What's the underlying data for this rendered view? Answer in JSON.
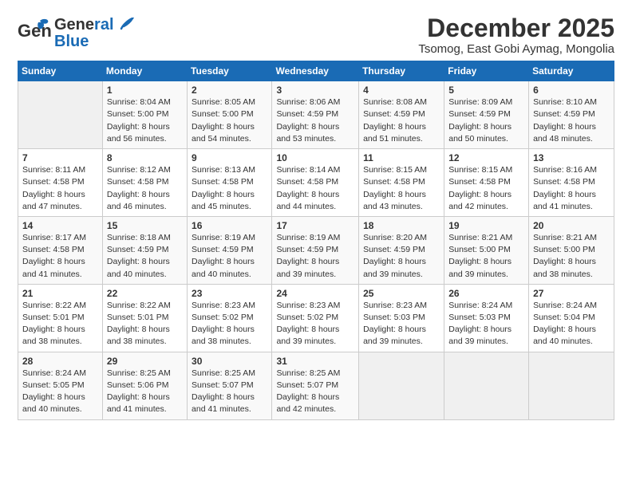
{
  "header": {
    "logo_line1": "General",
    "logo_line2": "Blue",
    "month_title": "December 2025",
    "subtitle": "Tsomog, East Gobi Aymag, Mongolia"
  },
  "days_of_week": [
    "Sunday",
    "Monday",
    "Tuesday",
    "Wednesday",
    "Thursday",
    "Friday",
    "Saturday"
  ],
  "weeks": [
    [
      {
        "day": "",
        "info": ""
      },
      {
        "day": "1",
        "info": "Sunrise: 8:04 AM\nSunset: 5:00 PM\nDaylight: 8 hours\nand 56 minutes."
      },
      {
        "day": "2",
        "info": "Sunrise: 8:05 AM\nSunset: 5:00 PM\nDaylight: 8 hours\nand 54 minutes."
      },
      {
        "day": "3",
        "info": "Sunrise: 8:06 AM\nSunset: 4:59 PM\nDaylight: 8 hours\nand 53 minutes."
      },
      {
        "day": "4",
        "info": "Sunrise: 8:08 AM\nSunset: 4:59 PM\nDaylight: 8 hours\nand 51 minutes."
      },
      {
        "day": "5",
        "info": "Sunrise: 8:09 AM\nSunset: 4:59 PM\nDaylight: 8 hours\nand 50 minutes."
      },
      {
        "day": "6",
        "info": "Sunrise: 8:10 AM\nSunset: 4:59 PM\nDaylight: 8 hours\nand 48 minutes."
      }
    ],
    [
      {
        "day": "7",
        "info": "Sunrise: 8:11 AM\nSunset: 4:58 PM\nDaylight: 8 hours\nand 47 minutes."
      },
      {
        "day": "8",
        "info": "Sunrise: 8:12 AM\nSunset: 4:58 PM\nDaylight: 8 hours\nand 46 minutes."
      },
      {
        "day": "9",
        "info": "Sunrise: 8:13 AM\nSunset: 4:58 PM\nDaylight: 8 hours\nand 45 minutes."
      },
      {
        "day": "10",
        "info": "Sunrise: 8:14 AM\nSunset: 4:58 PM\nDaylight: 8 hours\nand 44 minutes."
      },
      {
        "day": "11",
        "info": "Sunrise: 8:15 AM\nSunset: 4:58 PM\nDaylight: 8 hours\nand 43 minutes."
      },
      {
        "day": "12",
        "info": "Sunrise: 8:15 AM\nSunset: 4:58 PM\nDaylight: 8 hours\nand 42 minutes."
      },
      {
        "day": "13",
        "info": "Sunrise: 8:16 AM\nSunset: 4:58 PM\nDaylight: 8 hours\nand 41 minutes."
      }
    ],
    [
      {
        "day": "14",
        "info": "Sunrise: 8:17 AM\nSunset: 4:58 PM\nDaylight: 8 hours\nand 41 minutes."
      },
      {
        "day": "15",
        "info": "Sunrise: 8:18 AM\nSunset: 4:59 PM\nDaylight: 8 hours\nand 40 minutes."
      },
      {
        "day": "16",
        "info": "Sunrise: 8:19 AM\nSunset: 4:59 PM\nDaylight: 8 hours\nand 40 minutes."
      },
      {
        "day": "17",
        "info": "Sunrise: 8:19 AM\nSunset: 4:59 PM\nDaylight: 8 hours\nand 39 minutes."
      },
      {
        "day": "18",
        "info": "Sunrise: 8:20 AM\nSunset: 4:59 PM\nDaylight: 8 hours\nand 39 minutes."
      },
      {
        "day": "19",
        "info": "Sunrise: 8:21 AM\nSunset: 5:00 PM\nDaylight: 8 hours\nand 39 minutes."
      },
      {
        "day": "20",
        "info": "Sunrise: 8:21 AM\nSunset: 5:00 PM\nDaylight: 8 hours\nand 38 minutes."
      }
    ],
    [
      {
        "day": "21",
        "info": "Sunrise: 8:22 AM\nSunset: 5:01 PM\nDaylight: 8 hours\nand 38 minutes."
      },
      {
        "day": "22",
        "info": "Sunrise: 8:22 AM\nSunset: 5:01 PM\nDaylight: 8 hours\nand 38 minutes."
      },
      {
        "day": "23",
        "info": "Sunrise: 8:23 AM\nSunset: 5:02 PM\nDaylight: 8 hours\nand 38 minutes."
      },
      {
        "day": "24",
        "info": "Sunrise: 8:23 AM\nSunset: 5:02 PM\nDaylight: 8 hours\nand 39 minutes."
      },
      {
        "day": "25",
        "info": "Sunrise: 8:23 AM\nSunset: 5:03 PM\nDaylight: 8 hours\nand 39 minutes."
      },
      {
        "day": "26",
        "info": "Sunrise: 8:24 AM\nSunset: 5:03 PM\nDaylight: 8 hours\nand 39 minutes."
      },
      {
        "day": "27",
        "info": "Sunrise: 8:24 AM\nSunset: 5:04 PM\nDaylight: 8 hours\nand 40 minutes."
      }
    ],
    [
      {
        "day": "28",
        "info": "Sunrise: 8:24 AM\nSunset: 5:05 PM\nDaylight: 8 hours\nand 40 minutes."
      },
      {
        "day": "29",
        "info": "Sunrise: 8:25 AM\nSunset: 5:06 PM\nDaylight: 8 hours\nand 41 minutes."
      },
      {
        "day": "30",
        "info": "Sunrise: 8:25 AM\nSunset: 5:07 PM\nDaylight: 8 hours\nand 41 minutes."
      },
      {
        "day": "31",
        "info": "Sunrise: 8:25 AM\nSunset: 5:07 PM\nDaylight: 8 hours\nand 42 minutes."
      },
      {
        "day": "",
        "info": ""
      },
      {
        "day": "",
        "info": ""
      },
      {
        "day": "",
        "info": ""
      }
    ]
  ]
}
